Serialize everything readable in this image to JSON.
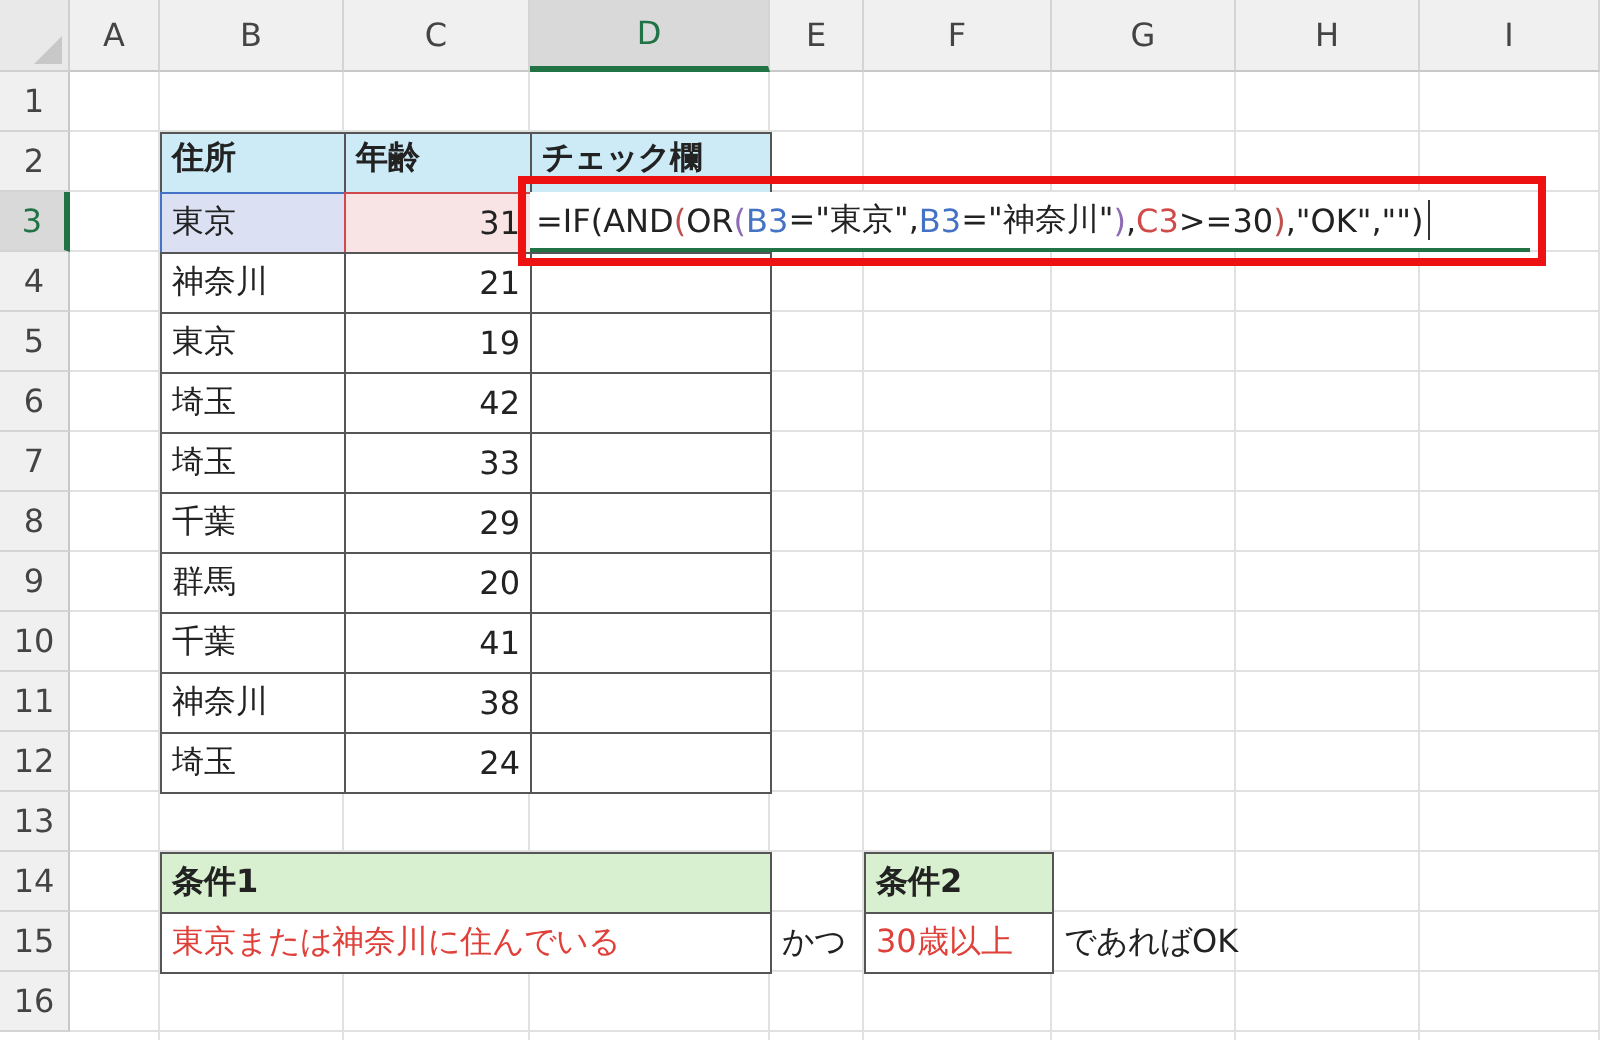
{
  "columns": [
    {
      "label": "A",
      "selected": false
    },
    {
      "label": "B",
      "selected": false
    },
    {
      "label": "C",
      "selected": false
    },
    {
      "label": "D",
      "selected": true
    },
    {
      "label": "E",
      "selected": false
    },
    {
      "label": "F",
      "selected": false
    },
    {
      "label": "G",
      "selected": false
    },
    {
      "label": "H",
      "selected": false
    },
    {
      "label": "I",
      "selected": false
    }
  ],
  "rows": [
    {
      "label": "1",
      "selected": false
    },
    {
      "label": "2",
      "selected": false
    },
    {
      "label": "3",
      "selected": true
    },
    {
      "label": "4",
      "selected": false
    },
    {
      "label": "5",
      "selected": false
    },
    {
      "label": "6",
      "selected": false
    },
    {
      "label": "7",
      "selected": false
    },
    {
      "label": "8",
      "selected": false
    },
    {
      "label": "9",
      "selected": false
    },
    {
      "label": "10",
      "selected": false
    },
    {
      "label": "11",
      "selected": false
    },
    {
      "label": "12",
      "selected": false
    },
    {
      "label": "13",
      "selected": false
    },
    {
      "label": "14",
      "selected": false
    },
    {
      "label": "15",
      "selected": false
    },
    {
      "label": "16",
      "selected": false
    }
  ],
  "table": {
    "header": [
      "住所",
      "年齢",
      "チェック欄"
    ],
    "rows": [
      {
        "address": "東京",
        "age": "31",
        "referenced": true
      },
      {
        "address": "神奈川",
        "age": "21",
        "referenced": false
      },
      {
        "address": "東京",
        "age": "19",
        "referenced": false
      },
      {
        "address": "埼玉",
        "age": "42",
        "referenced": false
      },
      {
        "address": "埼玉",
        "age": "33",
        "referenced": false
      },
      {
        "address": "千葉",
        "age": "29",
        "referenced": false
      },
      {
        "address": "群馬",
        "age": "20",
        "referenced": false
      },
      {
        "address": "千葉",
        "age": "41",
        "referenced": false
      },
      {
        "address": "神奈川",
        "age": "38",
        "referenced": false
      },
      {
        "address": "埼玉",
        "age": "24",
        "referenced": false
      }
    ]
  },
  "editor": {
    "parts": [
      {
        "text": "=IF(AND",
        "color": "#222222"
      },
      {
        "text": "(",
        "color": "#c0504d"
      },
      {
        "text": "OR",
        "color": "#222222"
      },
      {
        "text": "(",
        "color": "#8e6bb5"
      },
      {
        "text": "B3",
        "color": "#4472c4"
      },
      {
        "text": "=\"東京\",",
        "color": "#222222"
      },
      {
        "text": "B3",
        "color": "#4472c4"
      },
      {
        "text": "=\"神奈川\"",
        "color": "#222222"
      },
      {
        "text": ")",
        "color": "#8e6bb5"
      },
      {
        "text": ",",
        "color": "#222222"
      },
      {
        "text": "C3",
        "color": "#d04a4a"
      },
      {
        "text": ">=30",
        "color": "#222222"
      },
      {
        "text": ")",
        "color": "#c0504d"
      },
      {
        "text": ",\"OK\",\"\")",
        "color": "#222222"
      }
    ]
  },
  "conditions": {
    "header_1": "条件1",
    "text_1": "東京または神奈川に住んでいる",
    "joiner": "かつ",
    "header_2": "条件2",
    "text_2": "30歳以上",
    "suffix": "であればOK"
  }
}
